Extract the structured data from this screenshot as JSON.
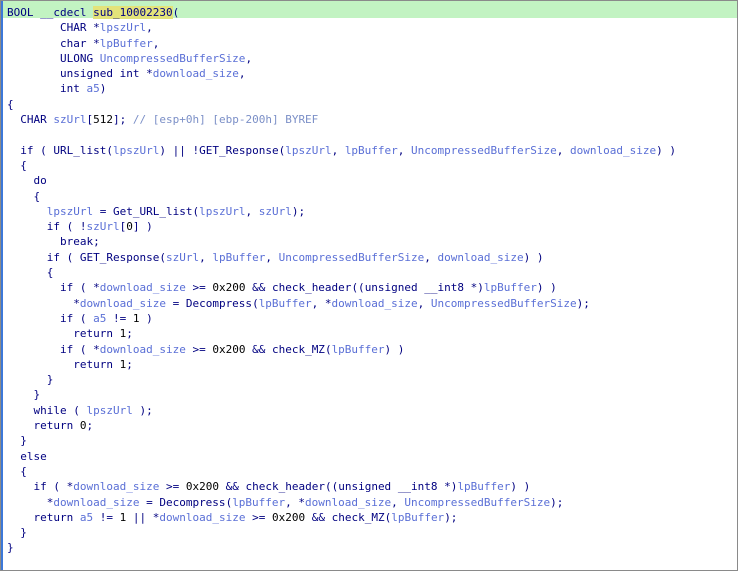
{
  "window": {
    "accent_colors": {
      "header_strip": "#c2f3c2",
      "function_highlight": "#e3e37a",
      "left_bar": "#3c78d8",
      "keyword": "#000080",
      "variable": "#5a6fd6",
      "comment": "#7b8fc7"
    }
  },
  "code": {
    "lines": [
      "BOOL __cdecl sub_10002230(",
      "        CHAR *lpszUrl,",
      "        char *lpBuffer,",
      "        ULONG UncompressedBufferSize,",
      "        unsigned int *download_size,",
      "        int a5)",
      "{",
      "  CHAR szUrl[512]; // [esp+0h] [ebp-200h] BYREF",
      "",
      "  if ( URL_list(lpszUrl) || !GET_Response(lpszUrl, lpBuffer, UncompressedBufferSize, download_size) )",
      "  {",
      "    do",
      "    {",
      "      lpszUrl = Get_URL_list(lpszUrl, szUrl);",
      "      if ( !szUrl[0] )",
      "        break;",
      "      if ( GET_Response(szUrl, lpBuffer, UncompressedBufferSize, download_size) )",
      "      {",
      "        if ( *download_size >= 0x200 && check_header((unsigned __int8 *)lpBuffer) )",
      "          *download_size = Decompress(lpBuffer, *download_size, UncompressedBufferSize);",
      "        if ( a5 != 1 )",
      "          return 1;",
      "        if ( *download_size >= 0x200 && check_MZ(lpBuffer) )",
      "          return 1;",
      "      }",
      "    }",
      "    while ( lpszUrl );",
      "    return 0;",
      "  }",
      "  else",
      "  {",
      "    if ( *download_size >= 0x200 && check_header((unsigned __int8 *)lpBuffer) )",
      "      *download_size = Decompress(lpBuffer, *download_size, UncompressedBufferSize);",
      "    return a5 != 1 || *download_size >= 0x200 && check_MZ(lpBuffer);",
      "  }",
      "}"
    ]
  }
}
